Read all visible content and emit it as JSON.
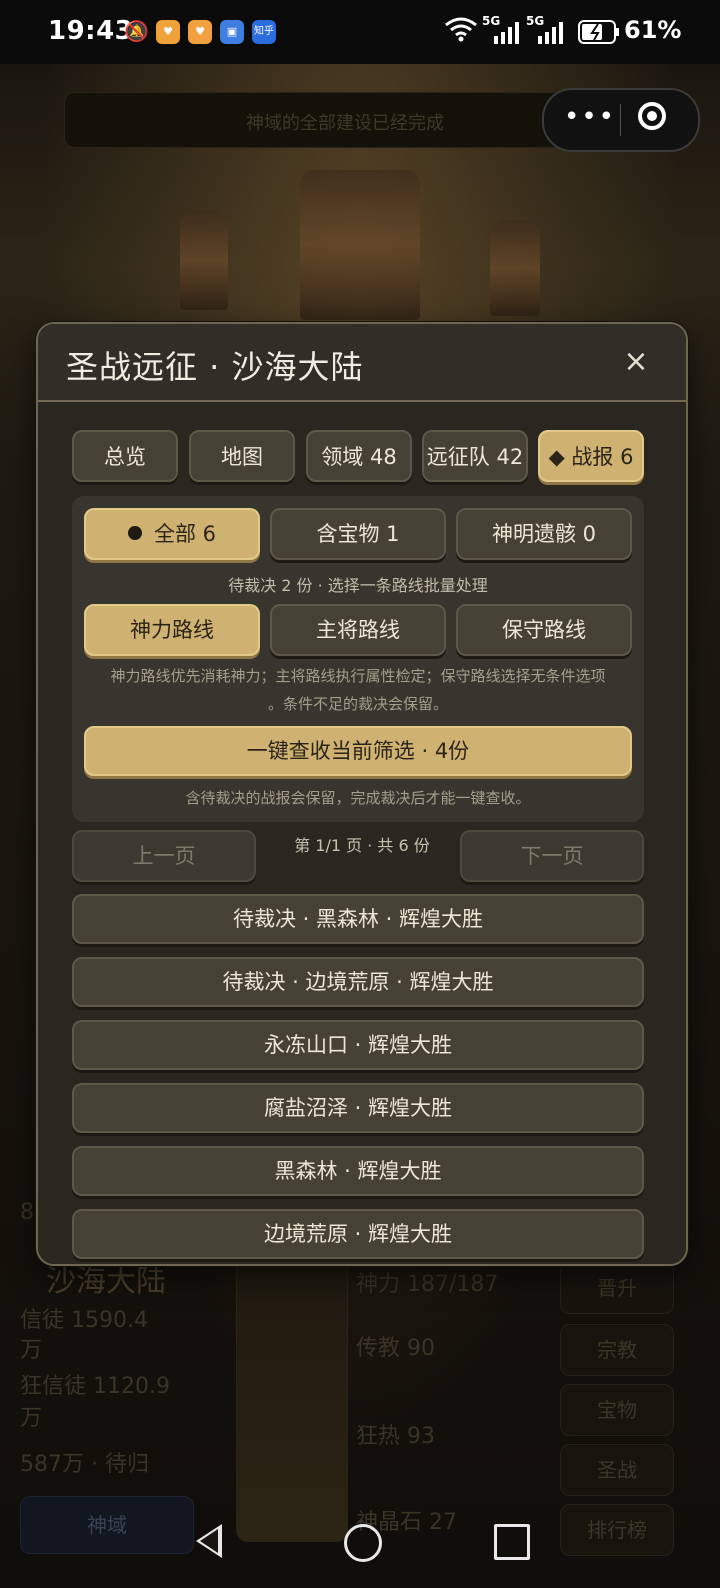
{
  "status_bar": {
    "time": "19:43",
    "app_icons": [
      "bell-muted-icon",
      "app-orange-icon",
      "app-orange-icon",
      "app-blue-icon",
      "zhihu-icon"
    ],
    "zhihu_label": "知乎",
    "network_1": "5G",
    "network_2": "5G",
    "battery": "61%"
  },
  "background": {
    "notice": "神域的全部建设已经完成",
    "region_name": "沙海大陆",
    "region_prefix": "8",
    "stats_left": [
      "信徒 1590.4",
      "万",
      "狂信徒 1120.9",
      "万",
      "587万 · 待归"
    ],
    "stats_mid": [
      "神力 187/187",
      "传教 90",
      "狂热 93",
      "神晶石 27"
    ],
    "side_buttons": [
      "晋升",
      "宗教",
      "宝物",
      "圣战",
      "排行榜"
    ],
    "domain_button": "神域"
  },
  "modal": {
    "title": "圣战远征 · 沙海大陆",
    "close_symbol": "×",
    "tabs": [
      {
        "label": "总览",
        "active": false
      },
      {
        "label": "地图",
        "active": false
      },
      {
        "label": "领域 48",
        "active": false
      },
      {
        "label": "远征队 42",
        "active": false
      },
      {
        "label": "◆ 战报 6",
        "active": true
      }
    ],
    "filters": [
      {
        "label": "全部 6",
        "active": true
      },
      {
        "label": "含宝物 1",
        "active": false
      },
      {
        "label": "神明遗骸 0",
        "active": false
      }
    ],
    "pending_hint": "待裁决 2 份 · 选择一条路线批量处理",
    "routes": [
      {
        "label": "神力路线",
        "active": true
      },
      {
        "label": "主将路线",
        "active": false
      },
      {
        "label": "保守路线",
        "active": false
      }
    ],
    "route_desc_1": "神力路线优先消耗神力；主将路线执行属性检定；保守路线选择无条件选项",
    "route_desc_2": "。条件不足的裁决会保留。",
    "collect_button": "一键查收当前筛选 · 4份",
    "collect_hint": "含待裁决的战报会保留，完成裁决后才能一键查收。",
    "prev_page": "上一页",
    "page_info": "第 1/1 页 · 共 6 份",
    "next_page": "下一页",
    "reports": [
      "待裁决 · 黑森林 · 辉煌大胜",
      "待裁决 · 边境荒原 · 辉煌大胜",
      "永冻山口 · 辉煌大胜",
      "腐盐沼泽 · 辉煌大胜",
      "黑森林 · 辉煌大胜",
      "边境荒原 · 辉煌大胜"
    ]
  },
  "colors": {
    "accent_gold": "#cfb271",
    "button_dark": "#454134",
    "modal_bg": "#292720"
  }
}
